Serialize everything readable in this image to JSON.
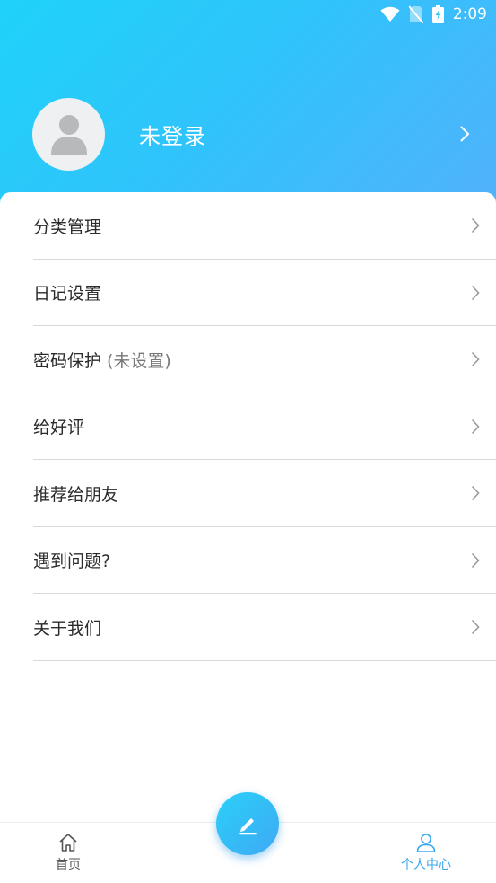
{
  "status_bar": {
    "time": "2:09"
  },
  "profile": {
    "login_text": "未登录"
  },
  "menu": [
    {
      "label": "分类管理",
      "sub": ""
    },
    {
      "label": "日记设置",
      "sub": ""
    },
    {
      "label": "密码保护",
      "sub": "(未设置)"
    },
    {
      "label": "给好评",
      "sub": ""
    },
    {
      "label": "推荐给朋友",
      "sub": ""
    },
    {
      "label": "遇到问题?",
      "sub": ""
    },
    {
      "label": "关于我们",
      "sub": ""
    }
  ],
  "tabs": {
    "home_label": "首页",
    "me_label": "个人中心"
  },
  "colors": {
    "accent": "#38a8f0",
    "header_start": "#1fd2f9",
    "header_end": "#52b1fb"
  }
}
